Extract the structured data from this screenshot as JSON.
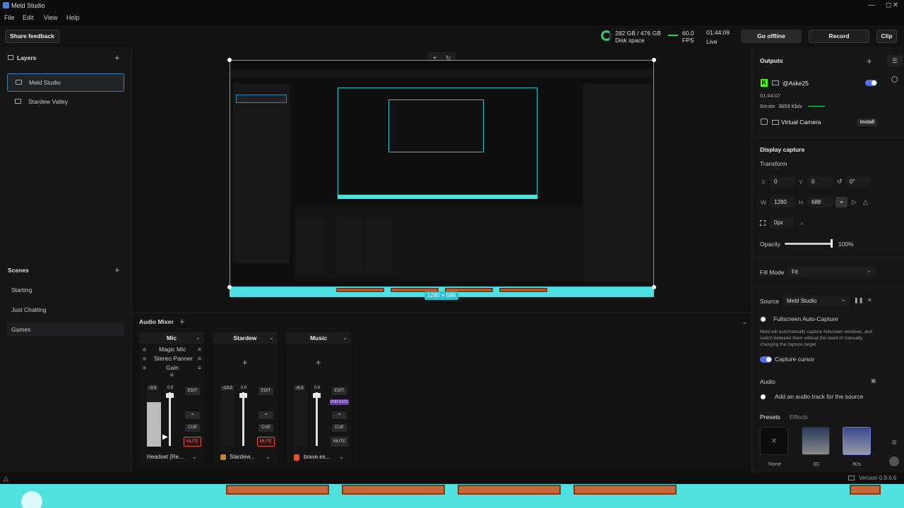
{
  "window": {
    "title": "Meld Studio"
  },
  "menu": [
    "File",
    "Edit",
    "View",
    "Help"
  ],
  "toolbar": {
    "share_feedback": "Share feedback",
    "disk": "282 GB / 476 GB",
    "disk_label": "Disk space",
    "fps": "60.0",
    "fps_label": "FPS",
    "time": "01:44:09",
    "time_label": "Live",
    "go_offline": "Go offline",
    "record": "Record",
    "clip": "Clip"
  },
  "layers": {
    "title": "Layers",
    "items": [
      {
        "label": "Meld Studio",
        "selected": true
      },
      {
        "label": "Stardew Valley",
        "selected": false
      }
    ]
  },
  "scenes": {
    "title": "Scenes",
    "items": [
      {
        "label": "Starting"
      },
      {
        "label": "Just Chatting"
      },
      {
        "label": "Games",
        "selected": true
      }
    ]
  },
  "canvas": {
    "size_label": "1280 × 688"
  },
  "mixer": {
    "title": "Audio Mixer",
    "channels": [
      {
        "name": "Mic",
        "fx": [
          "Magic Mic",
          "Stereo Panner",
          "Gain"
        ],
        "db": "-3.5",
        "gain": "0.0",
        "source": "Headset (Re...",
        "mute_active": true
      },
      {
        "name": "Stardew",
        "fx": [],
        "db": "-13.2",
        "gain": "0.0",
        "source": "Stardew...",
        "mute_active": true
      },
      {
        "name": "Music",
        "fx": [],
        "db": "-6.3",
        "gain": "0.0",
        "source": "brave.ex...",
        "mute_active": false,
        "badge": "VOD-EXCL"
      }
    ],
    "edit": "EDIT",
    "cue": "CUE",
    "mute": "MUTE",
    "meter_ticks": [
      "-6",
      "-12",
      "-18",
      "-24",
      "-30",
      "-36",
      "-42",
      "-48",
      "-54"
    ]
  },
  "outputs": {
    "title": "Outputs",
    "account": "@Aske25",
    "time": "01:44:07",
    "bitrate_label": "Bitrate",
    "bitrate": "3653 Kb/s",
    "virtual_camera": "Virtual Camera",
    "install": "Install"
  },
  "display_capture": {
    "title": "Display capture",
    "transform": "Transform",
    "x_label": "X",
    "x": "0",
    "y_label": "Y",
    "y": "0",
    "rot": "0°",
    "w_label": "W",
    "w": "1280",
    "h_label": "H",
    "h": "688",
    "corner": "0px",
    "opacity_label": "Opacity",
    "opacity": "100%",
    "fill_mode_label": "Fill Mode",
    "fill_mode": "Fit",
    "source_label": "Source",
    "source": "Meld Studio",
    "fullscreen": "Fullscreen Auto-Capture",
    "fullscreen_desc": "Meld will automatically capture fullscreen windows, and switch between them without the need of manually changing the capture target.",
    "capture_cursor": "Capture cursor",
    "audio_label": "Audio",
    "add_audio": "Add an audio track for the source",
    "presets_tab": "Presets",
    "effects_tab": "Effects",
    "presets": [
      "None",
      "3D",
      "90s"
    ]
  },
  "status": {
    "version": "Version 0.9.6.6"
  },
  "colors": {
    "accent": "#4f6ef7",
    "selection": "#2fc0d0",
    "mute": "#e05050",
    "kick": "#53fc18"
  }
}
